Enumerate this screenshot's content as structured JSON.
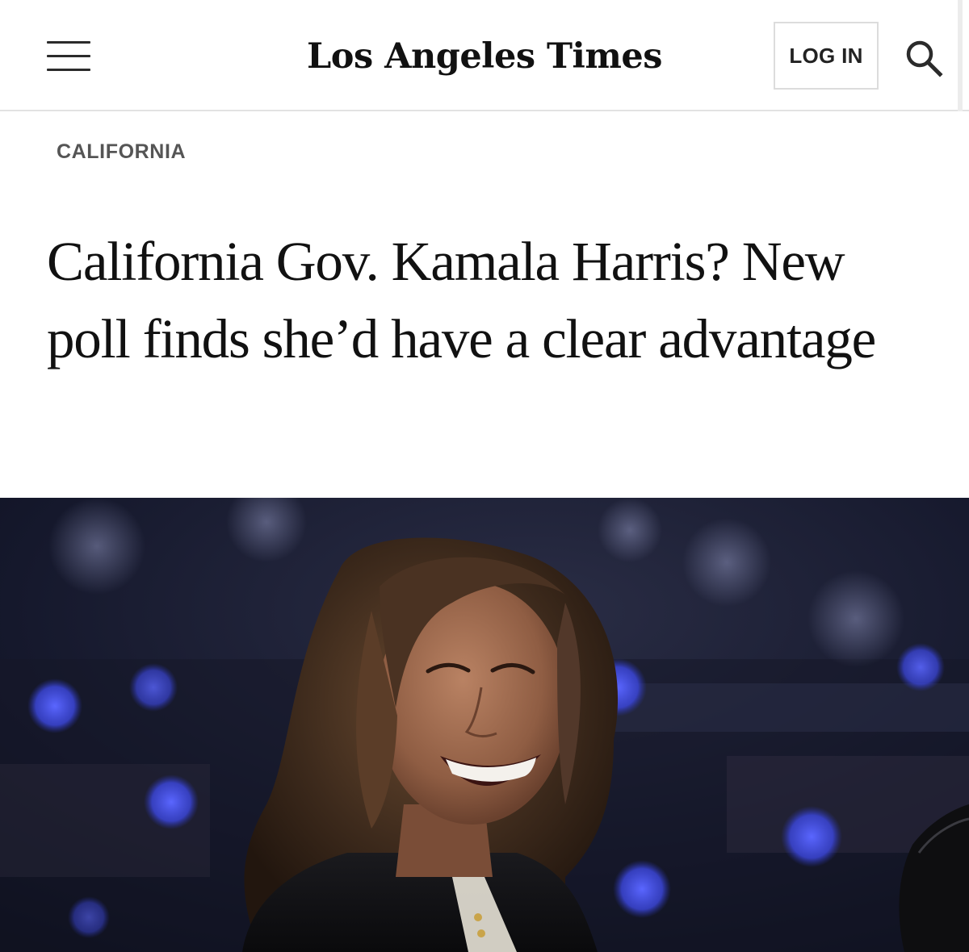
{
  "header": {
    "masthead": "Los Angeles Times",
    "login_label": "LOG IN",
    "menu_icon": "hamburger-menu-icon",
    "search_icon": "search-icon"
  },
  "article": {
    "section": "CALIFORNIA",
    "headline": "California Gov. Kamala Harris? New poll finds she’d have a clear advantage"
  },
  "colors": {
    "text": "#111111",
    "section_label": "#555555",
    "border": "#dcdcdc",
    "photo_background": "#0c0f1f",
    "bokeh_light": "#4450e6"
  }
}
